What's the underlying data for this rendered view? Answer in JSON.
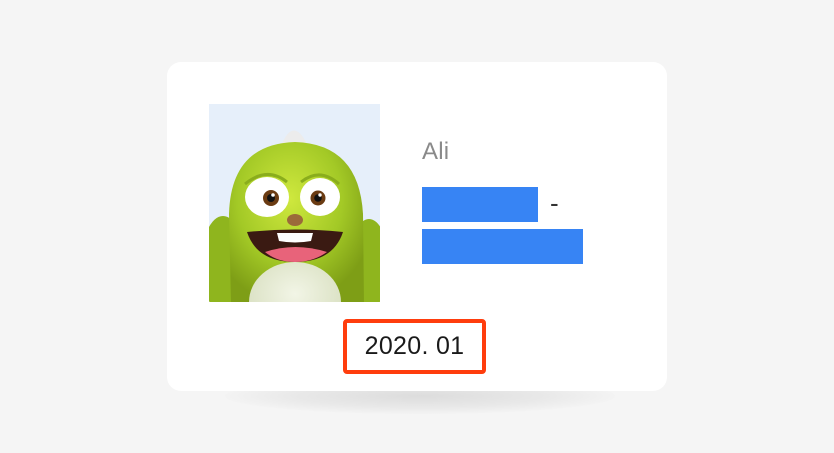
{
  "card": {
    "name": "Ali",
    "separator": "-",
    "date": "2020. 01",
    "avatar_icon": "green-monster-avatar"
  },
  "colors": {
    "redaction": "#3784f4",
    "highlight_border": "#ff3d0d",
    "avatar_body": "#a3c926"
  }
}
